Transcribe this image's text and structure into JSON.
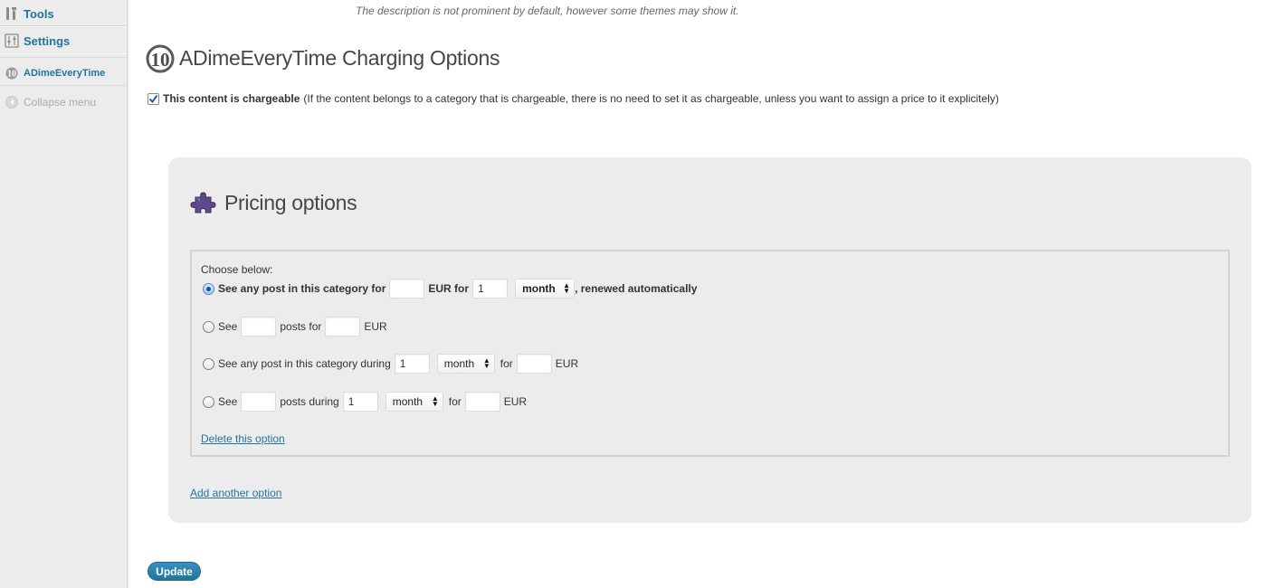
{
  "sidebar": {
    "tools_label": "Tools",
    "settings_label": "Settings",
    "plugin_label": "ADimeEveryTime",
    "collapse_label": "Collapse menu"
  },
  "description_note": "The description is not prominent by default, however some themes may show it.",
  "page_title": "ADimeEveryTime Charging Options",
  "chargeable": {
    "checked": true,
    "label": "This content is chargeable",
    "note": "(If the content belongs to a category that is chargeable, there is no need to set it as chargeable, unless you want to assign a price to it explicitely)"
  },
  "pricing": {
    "title": "Pricing options",
    "choose_label": "Choose below:",
    "options": [
      {
        "selected": true,
        "text_a": "See any post in this category for",
        "text_b": "EUR for",
        "period_value": "1",
        "period_unit": "month",
        "text_c": ", renewed automatically"
      },
      {
        "selected": false,
        "text_a": "See",
        "text_b": "posts for",
        "text_c": "EUR"
      },
      {
        "selected": false,
        "text_a": "See any post in this category during",
        "period_value": "1",
        "period_unit": "month",
        "text_b": "for",
        "text_c": "EUR"
      },
      {
        "selected": false,
        "text_a": "See",
        "text_b": "posts during",
        "period_value": "1",
        "period_unit": "month",
        "text_c": "for",
        "text_d": "EUR"
      }
    ],
    "delete_label": "Delete this option",
    "add_label": "Add another option"
  },
  "update_label": "Update",
  "colors": {
    "link": "#21759b",
    "panel_bg": "#ececec",
    "button": "#21759b"
  },
  "icons": [
    "tools-icon",
    "settings-icon",
    "plugin-logo-icon",
    "collapse-arrow-icon",
    "puzzle-icon"
  ]
}
